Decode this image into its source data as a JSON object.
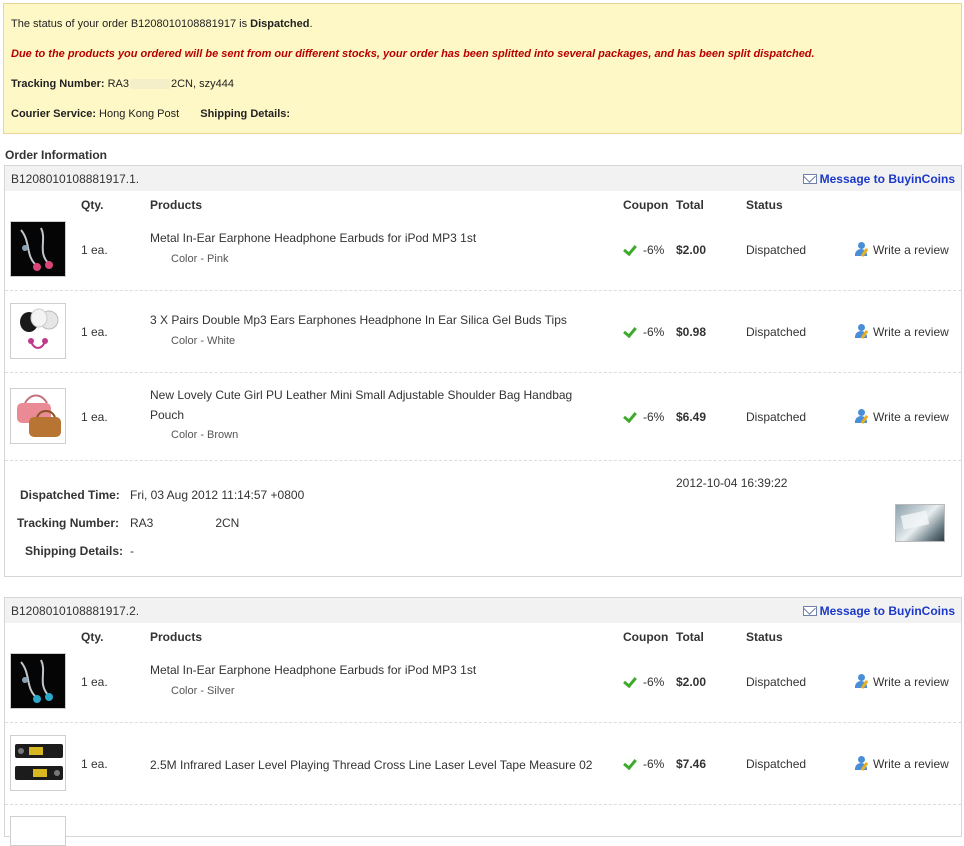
{
  "notice": {
    "status_prefix": "The status of your order ",
    "order_no": "B1208010108881917",
    "status_mid": " is ",
    "status_value": "Dispatched",
    "status_suffix": ".",
    "split_message": "Due to the products you ordered will be sent from our different stocks, your order has been splitted into several packages, and has been split dispatched.",
    "tracking_label": "Tracking Number:",
    "tracking_value_start": "RA3",
    "tracking_value_end": "2CN, szy444",
    "courier_label": "Courier Service:",
    "courier_value": "Hong Kong Post",
    "shipping_label": "Shipping Details:"
  },
  "section_title": "Order Information",
  "columns": {
    "qty": "Qty.",
    "products": "Products",
    "coupon": "Coupon",
    "total": "Total",
    "status": "Status"
  },
  "packages": [
    {
      "id": "B1208010108881917.1.",
      "message_label": "Message to BuyinCoins",
      "items": [
        {
          "qty": "1 ea.",
          "name": "Metal In-Ear Earphone Headphone Earbuds for iPod MP3 1st",
          "color": "Color - Pink",
          "coupon": "-6%",
          "total": "$2.00",
          "status": "Dispatched",
          "review": "Write a review",
          "thumb": "earbuds"
        },
        {
          "qty": "1 ea.",
          "name": "3 X Pairs Double Mp3 Ears Earphones Headphone In Ear Silica Gel Buds Tips",
          "color": "Color - White",
          "coupon": "-6%",
          "total": "$0.98",
          "status": "Dispatched",
          "review": "Write a review",
          "thumb": "ear-tips"
        },
        {
          "qty": "1 ea.",
          "name": "New Lovely Cute Girl PU Leather Mini Small Adjustable Shoulder Bag Handbag Pouch",
          "color": "Color - Brown",
          "coupon": "-6%",
          "total": "$6.49",
          "status": "Dispatched",
          "review": "Write a review",
          "thumb": "handbag"
        }
      ],
      "dispatch": {
        "time_label": "Dispatched Time:",
        "time_value": "Fri, 03 Aug 2012 11:14:57 +0800",
        "tracking_label": "Tracking Number:",
        "tracking_start": "RA3",
        "tracking_end": "2CN",
        "shipping_label": "Shipping Details:",
        "shipping_value": "-",
        "timestamp": "2012-10-04 16:39:22"
      }
    },
    {
      "id": "B1208010108881917.2.",
      "message_label": "Message to BuyinCoins",
      "items": [
        {
          "qty": "1 ea.",
          "name": "Metal In-Ear Earphone Headphone Earbuds for iPod MP3 1st",
          "color": "Color - Silver",
          "coupon": "-6%",
          "total": "$2.00",
          "status": "Dispatched",
          "review": "Write a review",
          "thumb": "earbuds"
        },
        {
          "qty": "1 ea.",
          "name": "2.5M Infrared Laser Level Playing Thread Cross Line Laser Level Tape Measure 02",
          "color": "",
          "coupon": "-6%",
          "total": "$7.46",
          "status": "Dispatched",
          "review": "Write a review",
          "thumb": "laser-level"
        }
      ]
    }
  ],
  "colors": {
    "notice_bg": "#fef8c6",
    "alert_red": "#b80000",
    "link_blue": "#1b38c8",
    "check_green": "#3eaa2c"
  }
}
